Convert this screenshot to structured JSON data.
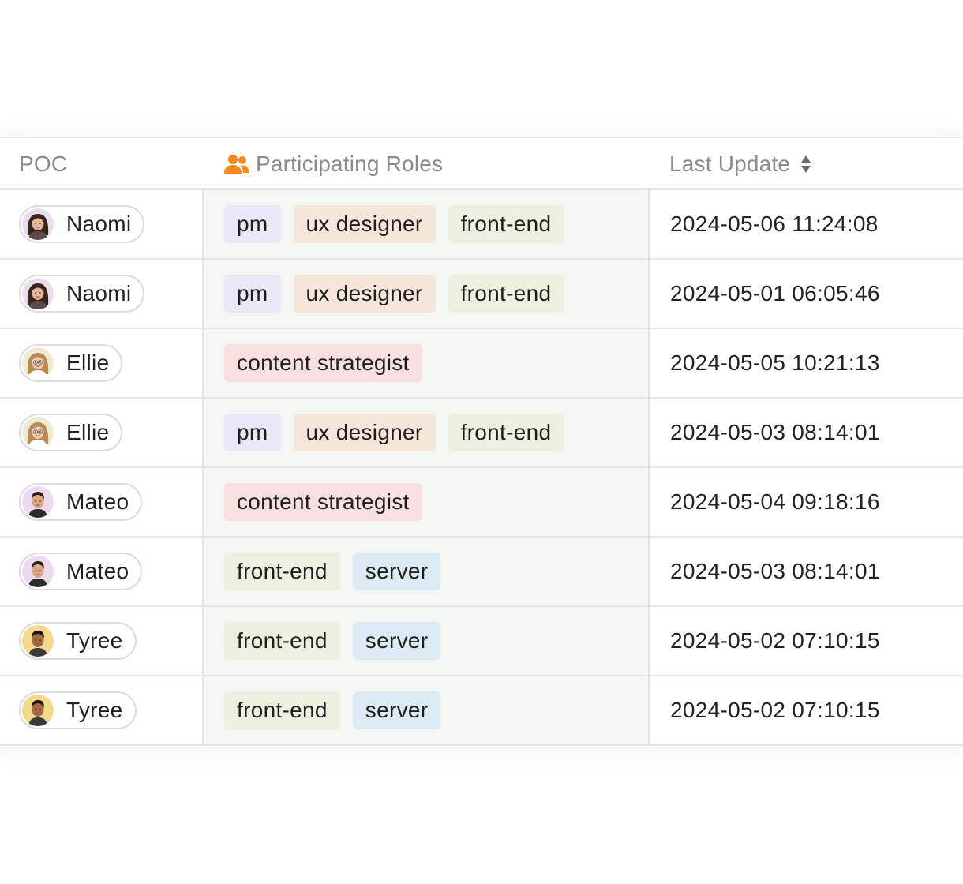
{
  "table": {
    "headers": {
      "poc": "POC",
      "roles": "Participating Roles",
      "last_update": "Last Update"
    },
    "roles_icon": "people-icon",
    "sort_icon": "sort-icon",
    "role_colors": {
      "pm": "#e8e9f7",
      "ux designer": "#f4e6d9",
      "front-end": "#ebf1df",
      "content strategist": "#f8e0e0",
      "server": "#dcebf3"
    },
    "rows": [
      {
        "poc": {
          "name": "Naomi",
          "avatar": "avatar-naomi"
        },
        "roles": [
          "pm",
          "ux designer",
          "front-end"
        ],
        "last_update": "2024-05-06 11:24:08"
      },
      {
        "poc": {
          "name": "Naomi",
          "avatar": "avatar-naomi"
        },
        "roles": [
          "pm",
          "ux designer",
          "front-end"
        ],
        "last_update": "2024-05-01 06:05:46"
      },
      {
        "poc": {
          "name": "Ellie",
          "avatar": "avatar-ellie"
        },
        "roles": [
          "content strategist"
        ],
        "last_update": "2024-05-05 10:21:13"
      },
      {
        "poc": {
          "name": "Ellie",
          "avatar": "avatar-ellie"
        },
        "roles": [
          "pm",
          "ux designer",
          "front-end"
        ],
        "last_update": "2024-05-03 08:14:01"
      },
      {
        "poc": {
          "name": "Mateo",
          "avatar": "avatar-mateo"
        },
        "roles": [
          "content strategist"
        ],
        "last_update": "2024-05-04 09:18:16"
      },
      {
        "poc": {
          "name": "Mateo",
          "avatar": "avatar-mateo"
        },
        "roles": [
          "front-end",
          "server"
        ],
        "last_update": "2024-05-03 08:14:01"
      },
      {
        "poc": {
          "name": "Tyree",
          "avatar": "avatar-tyree"
        },
        "roles": [
          "front-end",
          "server"
        ],
        "last_update": "2024-05-02 07:10:15"
      },
      {
        "poc": {
          "name": "Tyree",
          "avatar": "avatar-tyree"
        },
        "roles": [
          "front-end",
          "server"
        ],
        "last_update": "2024-05-02 07:10:15"
      }
    ]
  }
}
